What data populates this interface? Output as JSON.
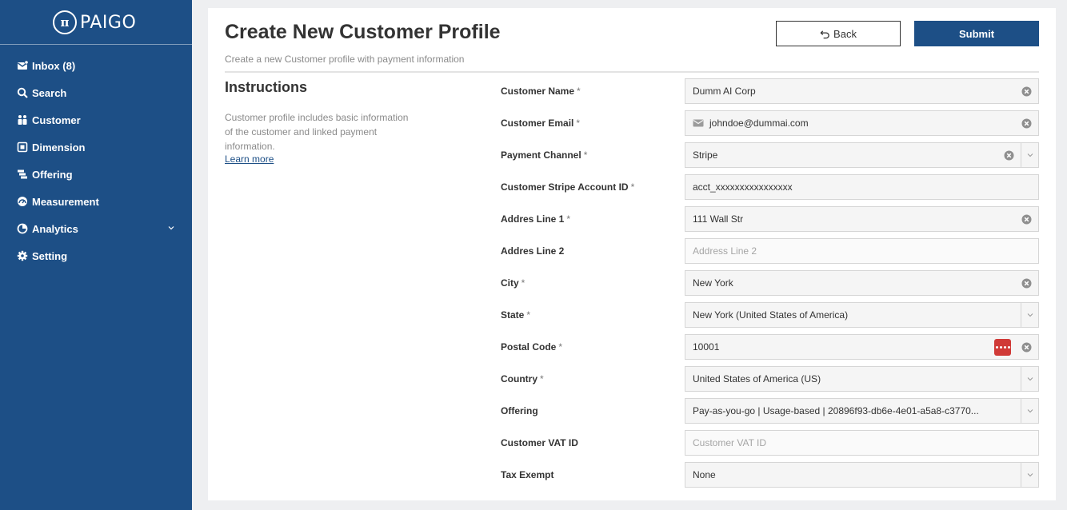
{
  "brand": {
    "name": "PAIGO",
    "mark": "π"
  },
  "sidebar": {
    "items": [
      {
        "label": "Inbox (8)",
        "icon": "inbox-icon"
      },
      {
        "label": "Search",
        "icon": "search-icon"
      },
      {
        "label": "Customer",
        "icon": "customer-icon"
      },
      {
        "label": "Dimension",
        "icon": "dimension-icon"
      },
      {
        "label": "Offering",
        "icon": "offering-icon"
      },
      {
        "label": "Measurement",
        "icon": "measurement-icon"
      },
      {
        "label": "Analytics",
        "icon": "analytics-icon"
      },
      {
        "label": "Setting",
        "icon": "gear-icon"
      }
    ]
  },
  "header": {
    "title": "Create New Customer Profile",
    "subtitle": "Create a new Customer profile with payment information",
    "back_label": "Back",
    "submit_label": "Submit"
  },
  "instructions": {
    "title": "Instructions",
    "text": "Customer profile includes basic information of the customer and linked payment information.",
    "link": "Learn more"
  },
  "form": {
    "fields": [
      {
        "label": "Customer Name",
        "required": "*",
        "value": "Dumm AI Corp"
      },
      {
        "label": "Customer Email",
        "required": "*",
        "value": "johndoe@dummai.com"
      },
      {
        "label": "Payment Channel",
        "required": "*",
        "value": "Stripe"
      },
      {
        "label": "Customer Stripe Account ID",
        "required": "*",
        "value": "acct_xxxxxxxxxxxxxxxx"
      },
      {
        "label": "Addres Line 1",
        "required": "*",
        "value": "111 Wall Str"
      },
      {
        "label": "Addres Line 2",
        "required": "",
        "placeholder": "Address Line 2"
      },
      {
        "label": "City",
        "required": "*",
        "value": "New York"
      },
      {
        "label": "State",
        "required": "*",
        "value": "New York (United States of America)"
      },
      {
        "label": "Postal Code",
        "required": "*",
        "value": "10001"
      },
      {
        "label": "Country",
        "required": "*",
        "value": "United States of America (US)"
      },
      {
        "label": "Offering",
        "required": "",
        "value": "Pay-as-you-go | Usage-based | 20896f93-db6e-4e01-a5a8-c3770..."
      },
      {
        "label": "Customer VAT ID",
        "required": "",
        "placeholder": "Customer VAT ID"
      },
      {
        "label": "Tax Exempt",
        "required": "",
        "value": "None"
      }
    ]
  },
  "colors": {
    "sidebar": "#1d4f86",
    "accent": "#1d4f86",
    "password_badge": "#d03a37"
  }
}
